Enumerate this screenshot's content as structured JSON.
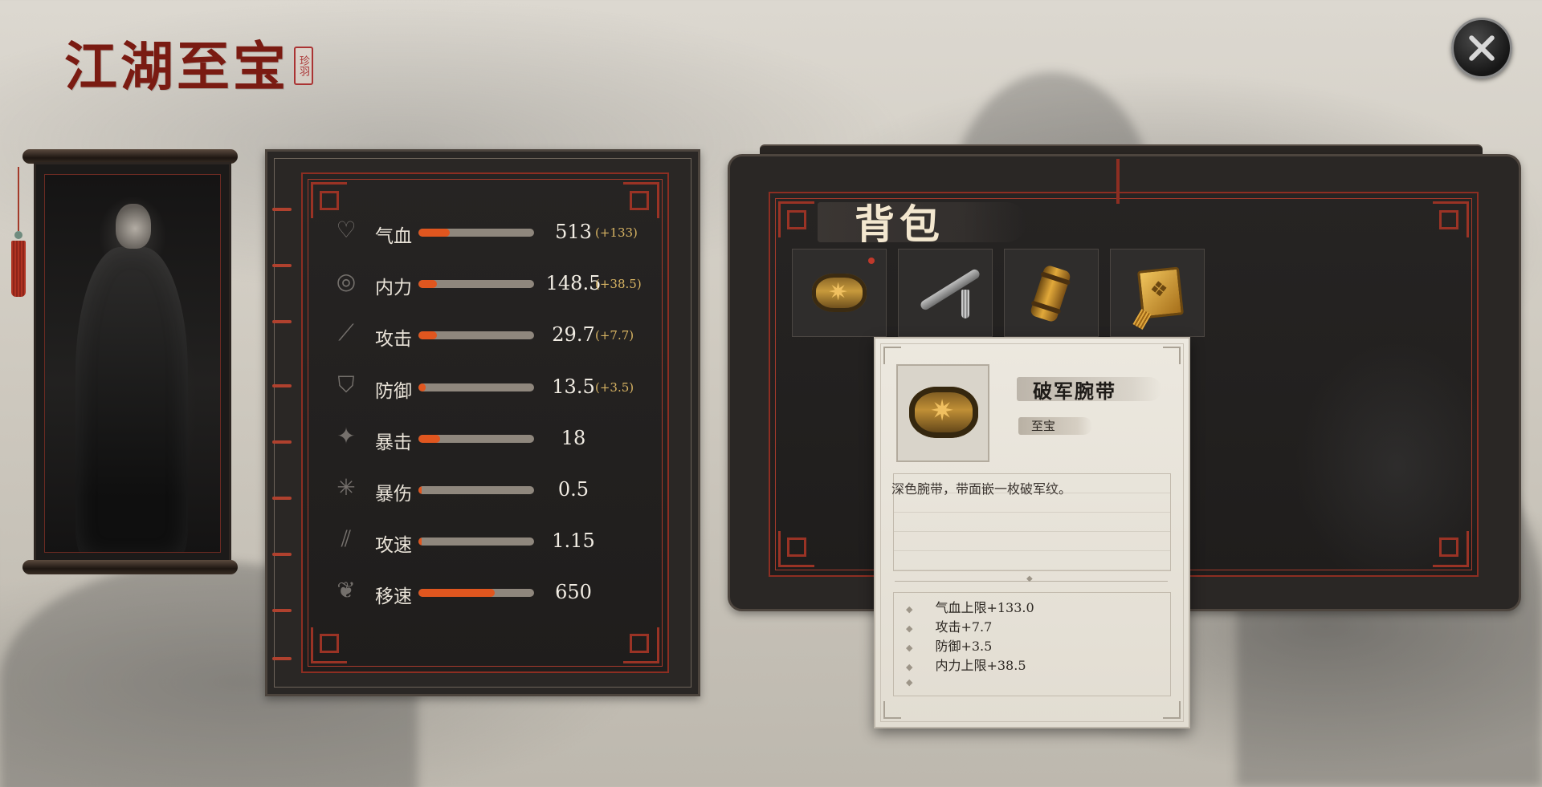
{
  "header": {
    "title": "江湖至宝",
    "seal": "珍羽"
  },
  "stats": [
    {
      "label": "气血",
      "value": "513",
      "bonus": "(+133)",
      "fill": 0.27,
      "icon": "heart-icon"
    },
    {
      "label": "内力",
      "value": "148.5",
      "bonus": "(+38.5)",
      "fill": 0.16,
      "icon": "swirl-icon"
    },
    {
      "label": "攻击",
      "value": "29.7",
      "bonus": "(+7.7)",
      "fill": 0.16,
      "icon": "sword-icon"
    },
    {
      "label": "防御",
      "value": "13.5",
      "bonus": "(+3.5)",
      "fill": 0.06,
      "icon": "shield-icon"
    },
    {
      "label": "暴击",
      "value": "18",
      "bonus": "",
      "fill": 0.19,
      "icon": "sparkle-icon"
    },
    {
      "label": "暴伤",
      "value": "0.5",
      "bonus": "",
      "fill": 0.03,
      "icon": "burst-icon"
    },
    {
      "label": "攻速",
      "value": "1.15",
      "bonus": "",
      "fill": 0.03,
      "icon": "blade-icon"
    },
    {
      "label": "移速",
      "value": "650",
      "bonus": "",
      "fill": 0.66,
      "icon": "feather-icon"
    }
  ],
  "bag": {
    "title": "背包",
    "items": [
      {
        "name": "bracelet",
        "icon": "bracelet-icon",
        "new": true
      },
      {
        "name": "flute",
        "icon": "flute-icon",
        "new": false
      },
      {
        "name": "tube",
        "icon": "tube-icon",
        "new": false
      },
      {
        "name": "pendant",
        "icon": "pendant-icon",
        "new": false
      }
    ]
  },
  "tooltip": {
    "name": "破军腕带",
    "rarity": "至宝",
    "description": "深色腕带，带面嵌一枚破军纹。",
    "attributes": [
      "气血上限+133.0",
      "攻击+7.7",
      "防御+3.5",
      "内力上限+38.5"
    ]
  },
  "colors": {
    "accent": "#e0561f",
    "frame_red": "#8d2e22",
    "title_red": "#7a1b12",
    "bonus_gold": "#d8b463"
  }
}
